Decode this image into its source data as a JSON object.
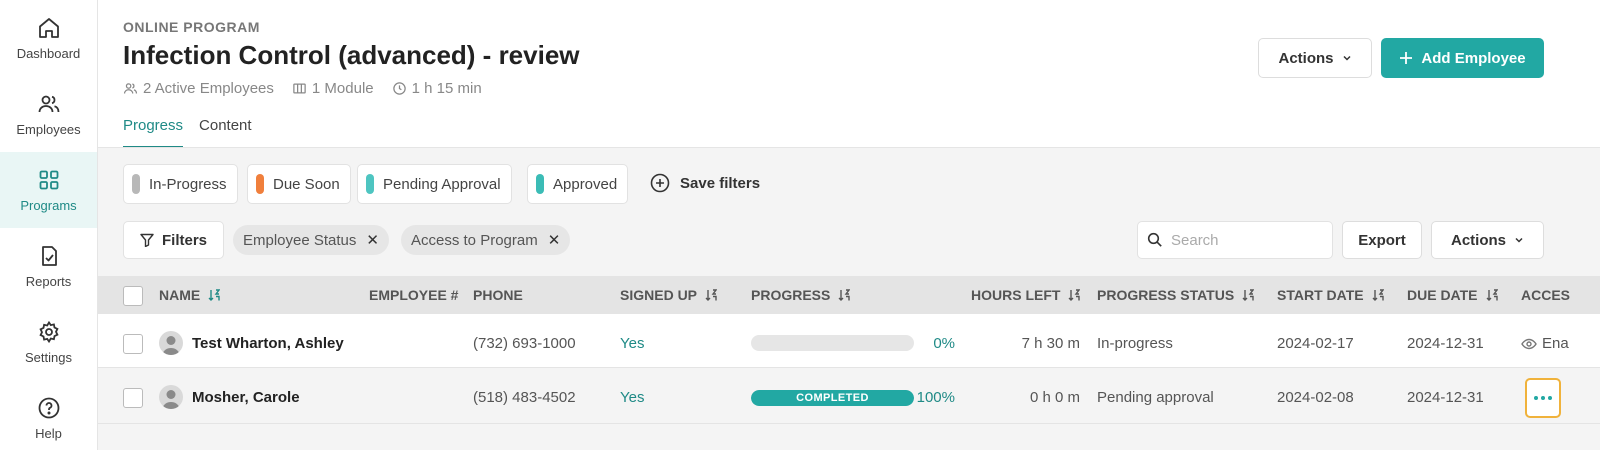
{
  "sidebar": {
    "items": [
      {
        "label": "Dashboard",
        "icon": "home-icon"
      },
      {
        "label": "Employees",
        "icon": "users-icon"
      },
      {
        "label": "Programs",
        "icon": "grid-icon",
        "active": true
      },
      {
        "label": "Reports",
        "icon": "report-icon"
      },
      {
        "label": "Settings",
        "icon": "gear-icon"
      },
      {
        "label": "Help",
        "icon": "help-icon"
      }
    ]
  },
  "header": {
    "eyebrow": "ONLINE PROGRAM",
    "title": "Infection Control (advanced) - review",
    "meta": {
      "employees": "2 Active Employees",
      "modules": "1 Module",
      "duration": "1 h 15 min"
    },
    "actions_label": "Actions",
    "add_employee_label": "Add Employee"
  },
  "tabs": [
    {
      "label": "Progress",
      "active": true
    },
    {
      "label": "Content",
      "active": false
    }
  ],
  "status_filters": [
    {
      "label": "In-Progress",
      "color": "#b8b8b8"
    },
    {
      "label": "Due Soon",
      "color": "#f07f3c"
    },
    {
      "label": "Pending Approval",
      "color": "#4ec5c1"
    },
    {
      "label": "Approved",
      "color": "#3bbcb6"
    }
  ],
  "save_filters_label": "Save filters",
  "toolbar": {
    "filters_label": "Filters",
    "active_filters": [
      "Employee Status",
      "Access to Program"
    ],
    "search_placeholder": "Search",
    "export_label": "Export",
    "actions_label": "Actions"
  },
  "table": {
    "columns": [
      "NAME",
      "EMPLOYEE #",
      "PHONE",
      "SIGNED UP",
      "PROGRESS",
      "HOURS LEFT",
      "PROGRESS STATUS",
      "START DATE",
      "DUE DATE",
      "ACCES"
    ],
    "rows": [
      {
        "name": "Test Wharton, Ashley",
        "employee_no": "",
        "phone": "(732) 693-1000",
        "signed_up": "Yes",
        "progress_pct": 0,
        "progress_label": "0%",
        "progress_bar_text": "",
        "hours_left": "7 h 30 m",
        "status": "In-progress",
        "start_date": "2024-02-17",
        "due_date": "2024-12-31",
        "access": "Ena"
      },
      {
        "name": "Mosher, Carole",
        "employee_no": "",
        "phone": "(518) 483-4502",
        "signed_up": "Yes",
        "progress_pct": 100,
        "progress_label": "100%",
        "progress_bar_text": "COMPLETED",
        "hours_left": "0 h 0 m",
        "status": "Pending approval",
        "start_date": "2024-02-08",
        "due_date": "2024-12-31",
        "access": ""
      }
    ]
  },
  "colors": {
    "accent": "#22a8a3",
    "accent_dark": "#1f8a86",
    "highlight_outline": "#f0b23b"
  }
}
